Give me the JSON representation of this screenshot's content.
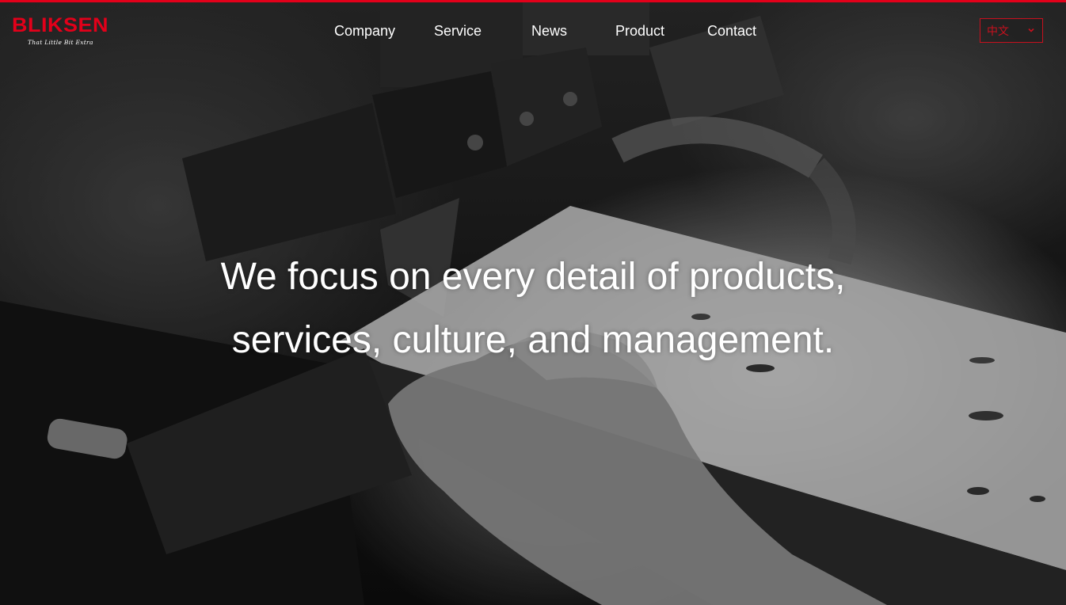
{
  "brand": {
    "name": "BLIKSEN",
    "tagline": "That Little Bit Extra",
    "accent_color": "#e2001a"
  },
  "nav": {
    "items": [
      {
        "label": "Company"
      },
      {
        "label": "Service"
      },
      {
        "label": "News"
      },
      {
        "label": "Product"
      },
      {
        "label": "Contact"
      }
    ]
  },
  "language": {
    "selected": "中文",
    "icon": "chevron-down-icon"
  },
  "hero": {
    "line1": "We focus on every detail of products,",
    "line2": "services, culture, and management."
  }
}
